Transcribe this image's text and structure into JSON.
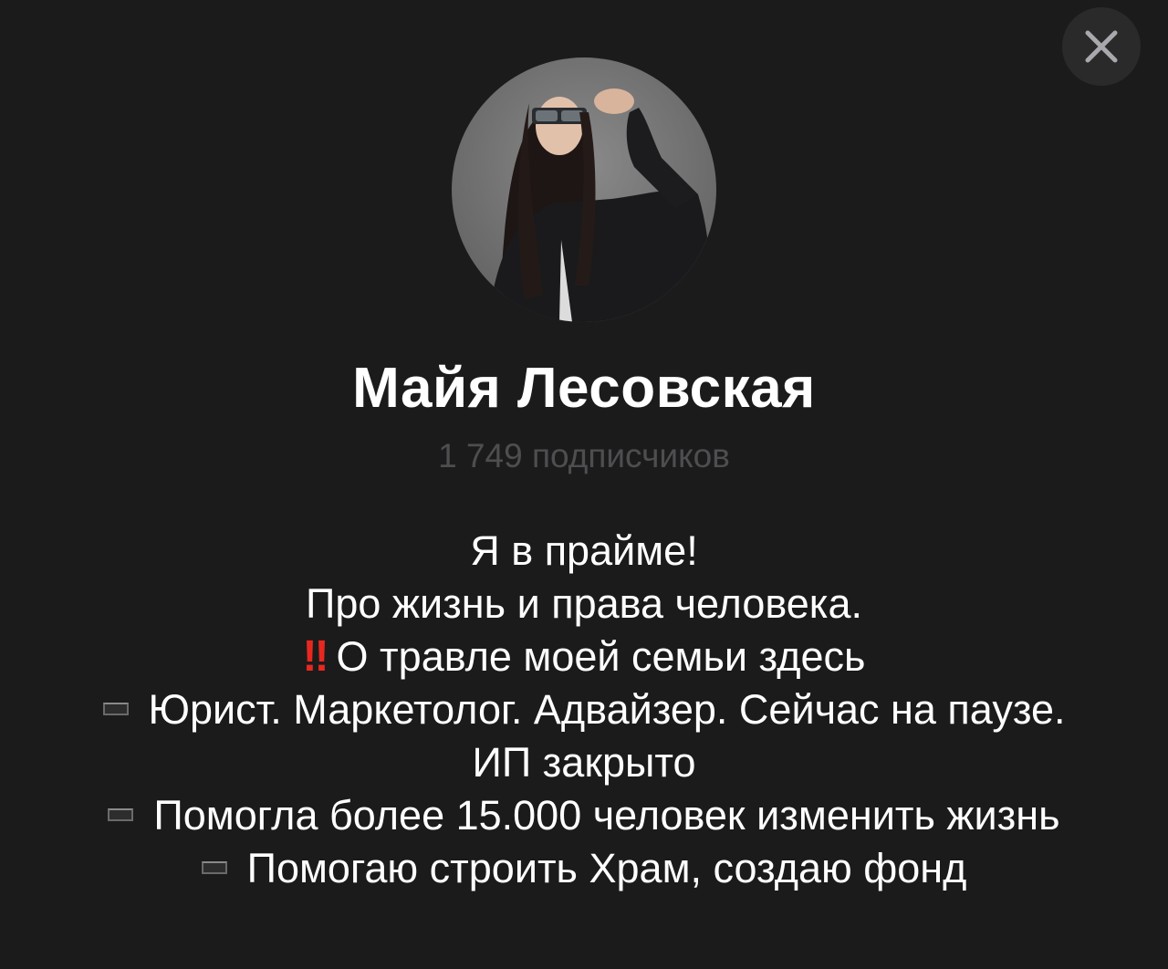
{
  "profile": {
    "name": "Майя Лесовская",
    "subscribers": "1 749 подписчиков"
  },
  "bio": {
    "line1": "Я в прайме!",
    "line2": "Про жизнь и права человека.",
    "line3_icon": "double-exclamation-icon",
    "line3_icon_text": "‼",
    "line3": "О травле моей семьи здесь",
    "line4": "Юрист. Маркетолог. Адвайзер. Сейчас на паузе. ИП закрыто",
    "line5": "Помогла более 15.000 человек изменить жизнь",
    "line6": "Помогаю строить Храм, создаю фонд"
  },
  "colors": {
    "background": "#1c1b1c",
    "close_button_bg": "#2a2a2b",
    "subscribers_text": "#4e4d50",
    "exclamation": "#e8281f"
  }
}
